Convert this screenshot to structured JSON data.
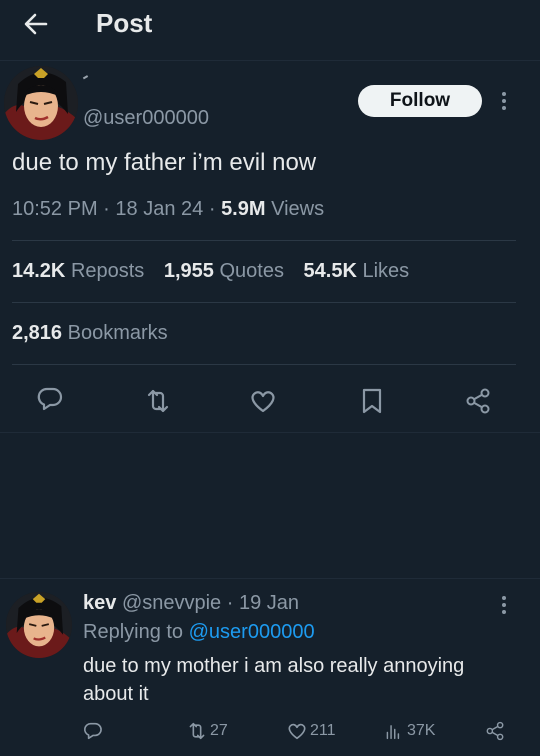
{
  "header": {
    "title": "Post"
  },
  "post": {
    "handle": "@user000000",
    "follow_label": "Follow",
    "text": "due to my father i’m evil now",
    "time": "10:52 PM",
    "date": "18 Jan 24",
    "views_count": "5.9M",
    "views_label": "Views",
    "separator": "·"
  },
  "stats": {
    "reposts_count": "14.2K",
    "reposts_label": "Reposts",
    "quotes_count": "1,955",
    "quotes_label": "Quotes",
    "likes_count": "54.5K",
    "likes_label": "Likes",
    "bookmarks_count": "2,816",
    "bookmarks_label": "Bookmarks"
  },
  "actions": [
    "reply-icon",
    "repost-icon",
    "like-icon",
    "bookmark-icon",
    "share-icon"
  ],
  "reply": {
    "name": "kev",
    "handle": "@snevvpie",
    "separator": "·",
    "date": "19 Jan",
    "replying_to_label": "Replying to",
    "replying_to_handle": "@user000000",
    "text": "due to my mother i am also really annoying about it",
    "retweets": "27",
    "likes": "211",
    "views": "37K"
  },
  "colors": {
    "background": "#15202b",
    "text_primary": "#e7e9ea",
    "text_secondary": "#8b98a5",
    "link": "#1d9bf0",
    "follow_bg": "#eff3f4",
    "divider": "#2b3845"
  }
}
